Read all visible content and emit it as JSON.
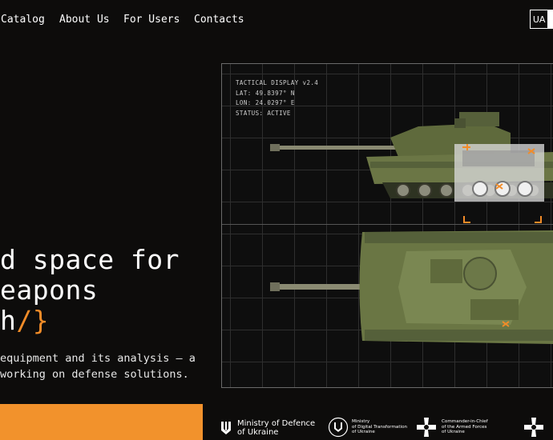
{
  "nav": {
    "items": [
      {
        "label": "Catalog"
      },
      {
        "label": "About Us"
      },
      {
        "label": "For Users"
      },
      {
        "label": "Contacts"
      }
    ],
    "lang_label": "UA"
  },
  "hero": {
    "line1": "d space for",
    "line2": "eapons",
    "line3_text": "h",
    "line3_accent": "/}"
  },
  "description": {
    "line1": " equipment and its analysis — a",
    "line2": "working on defense solutions."
  },
  "display": {
    "title": "TACTICAL DISPLAY v2.4",
    "lat": "LAT: 49.8397° N",
    "lon": "LON: 24.0297° E",
    "status": "STATUS: ACTIVE"
  },
  "partners": [
    {
      "line1": "Ministry of Defence",
      "line2": "of Ukraine",
      "icon": "trident-icon"
    },
    {
      "line1": "Ministry",
      "line2": "of Digital Transformation",
      "line3": "of Ukraine",
      "icon": "trident-icon"
    },
    {
      "line1": "Commander-in-Chief",
      "line2": "of the Armed Forces",
      "line3": "of Ukraine",
      "icon": "military-cross-icon"
    }
  ],
  "colors": {
    "accent": "#f28c28",
    "background": "#0d0c0b",
    "tank": "#6e7a4c"
  }
}
